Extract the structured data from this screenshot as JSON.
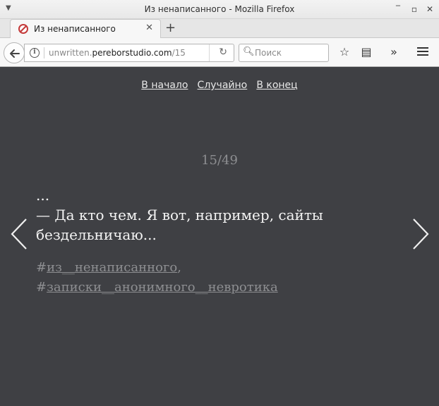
{
  "window": {
    "title": "Из ненаписанного - Mozilla Firefox"
  },
  "tabs": [
    {
      "label": "Из ненаписанного",
      "active": true
    }
  ],
  "navbar": {
    "url_prefix": "unwritten.",
    "url_domain": "pereborstudio.com",
    "url_path": "/15",
    "search_placeholder": "Поиск"
  },
  "page": {
    "nav": {
      "first": "В начало",
      "random": "Случайно",
      "last": "В конец"
    },
    "counter": "15/49",
    "entry_lines": [
      "...",
      "— Да кто чем. Я вот, например, сайты",
      "бездельничаю..."
    ],
    "tags": [
      {
        "hash": "#",
        "label": "из__ненаписанного",
        "sep": ","
      },
      {
        "hash": "#",
        "label": "записки__анонимного__невротика",
        "sep": ""
      }
    ]
  },
  "colors": {
    "page_bg": "#3f4044",
    "text": "#f4f4f4",
    "muted": "#8d8e91"
  }
}
